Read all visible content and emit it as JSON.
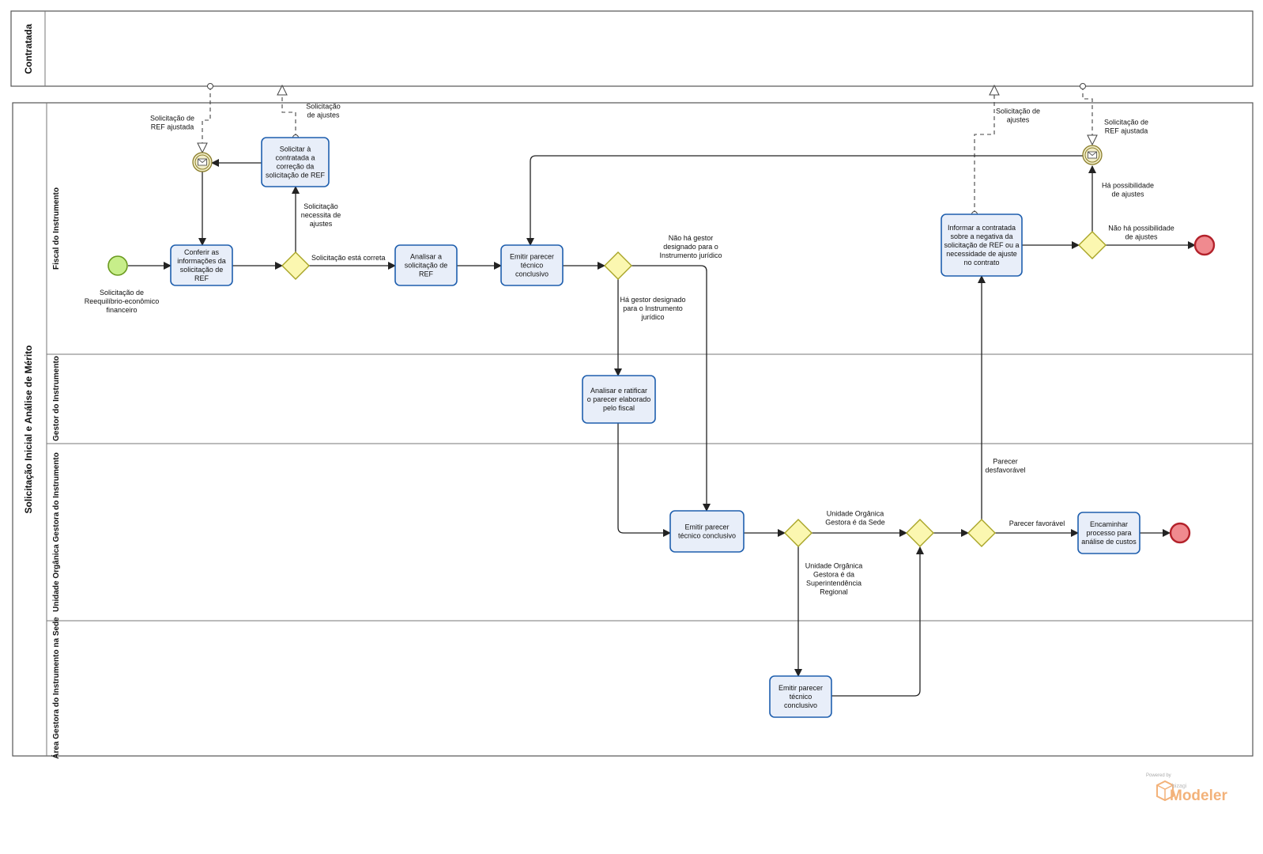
{
  "pools": {
    "contratada": "Contratada",
    "main": "Solicitação Inicial e Análise de Mérito"
  },
  "lanes": {
    "fiscal": "Fiscal do Instrumento",
    "gestor": "Gestor do Instrumento",
    "unidade": "Unidade Orgânica Gestora do Instrumento",
    "area": "Área Gestora do Instrumento na Sede"
  },
  "tasks": {
    "conferir": [
      "Conferir as",
      "informações da",
      "solicitação de",
      "REF"
    ],
    "solicitar": [
      "Solicitar à",
      "contratada a",
      "correção da",
      "solicitação de REF"
    ],
    "analisar": [
      "Analisar a",
      "solicitação de",
      "REF"
    ],
    "emitir1": [
      "Emitir parecer",
      "técnico",
      "conclusivo"
    ],
    "ratificar": [
      "Analisar e ratificar",
      "o parecer elaborado",
      "pelo fiscal"
    ],
    "emitir2": [
      "Emitir parecer",
      "técnico conclusivo"
    ],
    "emitir3": [
      "Emitir parecer",
      "técnico",
      "conclusivo"
    ],
    "encaminhar": [
      "Encaminhar",
      "processo para",
      "análise de custos"
    ],
    "informar": [
      "Informar a contratada",
      "sobre a negativa da",
      "solicitação de REF ou a",
      "necessidade de ajuste",
      "no contrato"
    ]
  },
  "labels": {
    "start": [
      "Solicitação de",
      "Reequilíbrio-econômico",
      "financeiro"
    ],
    "ref_ajustada_left": [
      "Solicitação de",
      "REF ajustada"
    ],
    "ajustes_left": [
      "Solicitação",
      "de ajustes"
    ],
    "necessita": [
      "Solicitação",
      "necessita de",
      "ajustes"
    ],
    "correta": [
      "Solicitação está correta"
    ],
    "nao_gestor": [
      "Não há gestor",
      "designado para o",
      "Instrumento jurídico"
    ],
    "ha_gestor": [
      "Há gestor designado",
      "para o Instrumento",
      "jurídico"
    ],
    "sede": [
      "Unidade Orgânica",
      "Gestora é da Sede"
    ],
    "superintendencia": [
      "Unidade Orgânica",
      "Gestora é da",
      "Superintendência",
      "Regional"
    ],
    "desfavoravel": [
      "Parecer",
      "desfavorável"
    ],
    "favoravel": [
      "Parecer favorável"
    ],
    "ajustes_right": [
      "Solicitação de",
      "ajustes"
    ],
    "ref_ajustada_right": [
      "Solicitação de",
      "REF ajustada"
    ],
    "ha_possibilidade": [
      "Há possibilidade",
      "de ajustes"
    ],
    "nao_possibilidade": [
      "Não há possibilidade",
      "de ajustes"
    ]
  },
  "watermark": {
    "powered": "Powered by",
    "brand": "bizagi",
    "product": "Modeler"
  },
  "colors": {
    "task_fill": "#e8eef9",
    "task_stroke": "#1f5fae",
    "gateway_fill": "#fbf7b0",
    "start_fill": "#c7ee8a",
    "end_fill": "#f08a8f",
    "watermark": "#f3b27a"
  }
}
